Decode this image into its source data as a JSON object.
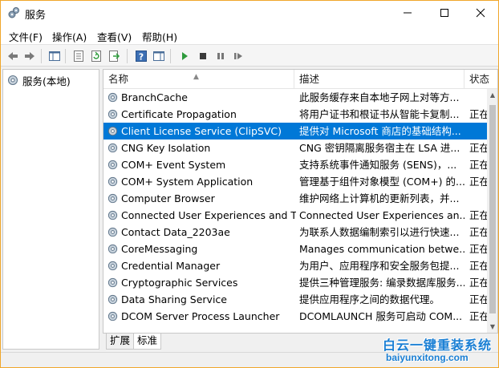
{
  "window": {
    "title": "服务"
  },
  "menu": [
    "文件(F)",
    "操作(A)",
    "查看(V)",
    "帮助(H)"
  ],
  "tree": {
    "root_label": "服务(本地)"
  },
  "table": {
    "columns": {
      "name": "名称",
      "description": "描述",
      "status": "状态"
    },
    "rows": [
      {
        "name": "BranchCache",
        "desc": "此服务缓存来自本地子网上对等方...",
        "status": "",
        "selected": false
      },
      {
        "name": "Certificate Propagation",
        "desc": "将用户证书和根证书从智能卡复制...",
        "status": "正在",
        "selected": false
      },
      {
        "name": "Client License Service (ClipSVC)",
        "desc": "提供对 Microsoft 商店的基础结构...",
        "status": "",
        "selected": true
      },
      {
        "name": "CNG Key Isolation",
        "desc": "CNG 密钥隔离服务宿主在 LSA 进...",
        "status": "正在",
        "selected": false
      },
      {
        "name": "COM+ Event System",
        "desc": "支持系统事件通知服务 (SENS)，...",
        "status": "正在",
        "selected": false
      },
      {
        "name": "COM+ System Application",
        "desc": "管理基于组件对象模型 (COM+) 的...",
        "status": "正在",
        "selected": false
      },
      {
        "name": "Computer Browser",
        "desc": "维护网络上计算机的更新列表，并...",
        "status": "",
        "selected": false
      },
      {
        "name": "Connected User Experiences and T...",
        "desc": "Connected User Experiences an...",
        "status": "正在",
        "selected": false
      },
      {
        "name": "Contact Data_2203ae",
        "desc": "为联系人数据编制索引以进行快速...",
        "status": "正在",
        "selected": false
      },
      {
        "name": "CoreMessaging",
        "desc": "Manages communication betwe...",
        "status": "正在",
        "selected": false
      },
      {
        "name": "Credential Manager",
        "desc": "为用户、应用程序和安全服务包提...",
        "status": "正在",
        "selected": false
      },
      {
        "name": "Cryptographic Services",
        "desc": "提供三种管理服务: 编录数据库服务...",
        "status": "正在",
        "selected": false
      },
      {
        "name": "Data Sharing Service",
        "desc": "提供应用程序之间的数据代理。",
        "status": "正在",
        "selected": false
      },
      {
        "name": "DCOM Server Process Launcher",
        "desc": "DCOMLAUNCH 服务可启动 COM...",
        "status": "正在",
        "selected": false
      }
    ]
  },
  "tabs": [
    "扩展",
    "标准"
  ],
  "watermark": {
    "line1": "白云一键重装系统",
    "line2": "baiyunxitong.com"
  },
  "colors": {
    "selection": "#0078d7",
    "window_border": "#f0a62a",
    "watermark": "#1a7fd4"
  },
  "icons": [
    "services-app-icon",
    "minimize-icon",
    "maximize-icon",
    "close-icon",
    "back-arrow-icon",
    "forward-arrow-icon",
    "console-tree-icon",
    "properties-icon",
    "refresh-icon",
    "export-icon",
    "help-icon",
    "show-pane-icon",
    "start-icon",
    "stop-icon",
    "pause-icon",
    "restart-icon",
    "gear-icon"
  ]
}
